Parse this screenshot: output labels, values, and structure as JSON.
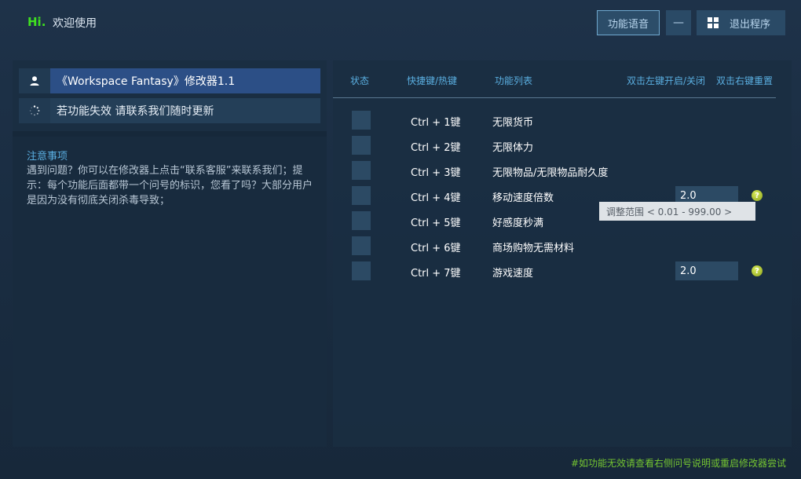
{
  "header": {
    "hi": "Hi.",
    "welcome": "欢迎使用",
    "voice_button": "功能语音",
    "minimize_button": "—",
    "exit_button": "退出程序"
  },
  "left": {
    "title": "《Workspace  Fantasy》修改器1.1",
    "update_notice": "若功能失效  请联系我们随时更新",
    "notice_title": "注意事项",
    "notice_body": "遇到问题？你可以在修改器上点击“联系客服”来联系我们；提示：每个功能后面都带一个问号的标识，您看了吗？大部分用户是因为没有彻底关闭杀毒导致；"
  },
  "table": {
    "headers": {
      "status": "状态",
      "hotkey": "快捷键/热键",
      "function": "功能列表",
      "dbl_left": "双击左键开启/关闭",
      "dbl_right": "双击右键重置"
    },
    "rows": [
      {
        "hotkey": "Ctrl  +  1键",
        "name": "无限货币"
      },
      {
        "hotkey": "Ctrl  +  2键",
        "name": "无限体力"
      },
      {
        "hotkey": "Ctrl  +  3键",
        "name": "无限物品/无限物品耐久度"
      },
      {
        "hotkey": "Ctrl  +  4键",
        "name": "移动速度倍数",
        "value": "2.0",
        "help": "?"
      },
      {
        "hotkey": "Ctrl  +  5键",
        "name": "好感度秒满"
      },
      {
        "hotkey": "Ctrl  +  6键",
        "name": "商场购物无需材料"
      },
      {
        "hotkey": "Ctrl  +  7键",
        "name": "游戏速度",
        "value": "2.0",
        "help": "?"
      }
    ]
  },
  "tooltip": "调整范围  < 0.01 - 999.00 >",
  "footer": "#如功能无效请查看右侧问号说明或重启修改器尝试",
  "colors": {
    "accent_green": "#3fe020",
    "header_blue": "#5aaee0",
    "footer_green": "#74c531",
    "title_bar": "#2c4f86"
  }
}
